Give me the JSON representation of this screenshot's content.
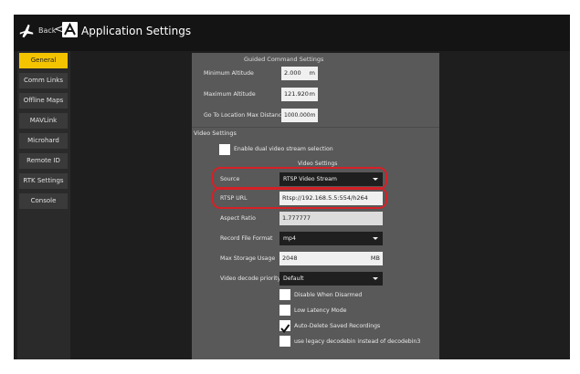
{
  "topbar": {
    "back_label": "Back",
    "chevron": "<",
    "title": "Application Settings",
    "icons": {
      "vehicle": "plane-icon",
      "logo": "app-logo-icon"
    }
  },
  "sidebar": {
    "items": [
      {
        "label": "General",
        "active": true
      },
      {
        "label": "Comm Links",
        "active": false
      },
      {
        "label": "Offline Maps",
        "active": false
      },
      {
        "label": "MAVLink",
        "active": false
      },
      {
        "label": "Microhard",
        "active": false
      },
      {
        "label": "Remote ID",
        "active": false
      },
      {
        "label": "RTK Settings",
        "active": false
      },
      {
        "label": "Console",
        "active": false
      }
    ]
  },
  "guided": {
    "title": "Guided Command Settings",
    "min_alt_label": "Minimum Altitude",
    "min_alt_value": "2.000",
    "min_alt_unit": "m",
    "max_alt_label": "Maximum Altitude",
    "max_alt_value": "121.920",
    "max_alt_unit": "m",
    "goto_label": "Go To Location Max Distance",
    "goto_value": "1000.000m"
  },
  "video": {
    "section_label": "Video Settings",
    "dual_stream_label": "Enable dual video stream selection",
    "subtitle": "Video Settings",
    "source_label": "Source",
    "source_value": "RTSP Video Stream",
    "rtsp_label": "RTSP URL",
    "rtsp_value": "Rtsp://192.168.5.5:554/h264",
    "aspect_label": "Aspect Ratio",
    "aspect_value": "1.777777",
    "record_label": "Record File Format",
    "record_value": "mp4",
    "storage_label": "Max Storage Usage",
    "storage_value": "2048",
    "storage_unit": "MB",
    "decode_label": "Video decode priority",
    "decode_value": "Default",
    "checkboxes": [
      {
        "label": "Disable When Disarmed",
        "checked": false
      },
      {
        "label": "Low Latency Mode",
        "checked": false
      },
      {
        "label": "Auto-Delete Saved Recordings",
        "checked": true
      },
      {
        "label": "use legacy decodebin instead of decodebin3",
        "checked": false
      }
    ]
  },
  "colors": {
    "accent": "#f5c400",
    "highlight": "#d62027"
  }
}
